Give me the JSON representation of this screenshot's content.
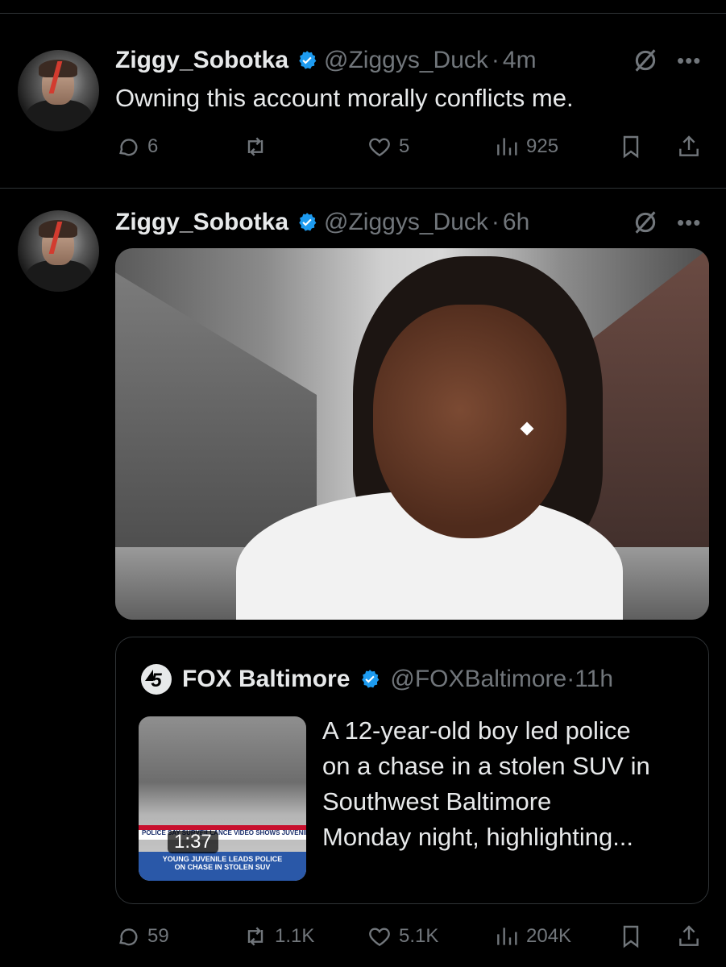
{
  "posts": [
    {
      "author": "Ziggy_Sobotka",
      "handle": "@Ziggys_Duck",
      "separator": "·",
      "time": "4m",
      "text": "Owning this account morally conflicts me.",
      "stats": {
        "replies": "6",
        "reposts": "",
        "likes": "5",
        "views": "925"
      }
    },
    {
      "author": "Ziggy_Sobotka",
      "handle": "@Ziggys_Duck",
      "separator": "·",
      "time": "6h",
      "stats": {
        "replies": "59",
        "reposts": "1.1K",
        "likes": "5.1K",
        "views": "204K"
      },
      "quote": {
        "author": "FOX Baltimore",
        "handle": "@FOXBaltimore",
        "separator": "·",
        "time": "11h",
        "lines": [
          "A 12-year-old boy led police",
          "on a chase in a stolen SUV in",
          "Southwest Baltimore",
          "Monday night, highlighting..."
        ],
        "video_duration": "1:37",
        "video_caption_top": "POLICE SAY SURVEILLANCE VIDEO SHOWS JUVENILE IN SW BALTIMORE",
        "video_caption_bottom": "YOUNG JUVENILE LEADS POLICE ON CHASE IN STOLEN SUV"
      }
    }
  ],
  "icons": {
    "verified": "verified-badge-icon",
    "grok": "grok-icon",
    "more": "more-icon",
    "reply": "reply-icon",
    "repost": "repost-icon",
    "like": "like-icon",
    "views": "views-icon",
    "bookmark": "bookmark-icon",
    "share": "share-icon"
  },
  "colors": {
    "background": "#000000",
    "text": "#e7e9ea",
    "muted": "#71767b",
    "verified": "#1d9bf0",
    "divider": "#2f3336"
  }
}
